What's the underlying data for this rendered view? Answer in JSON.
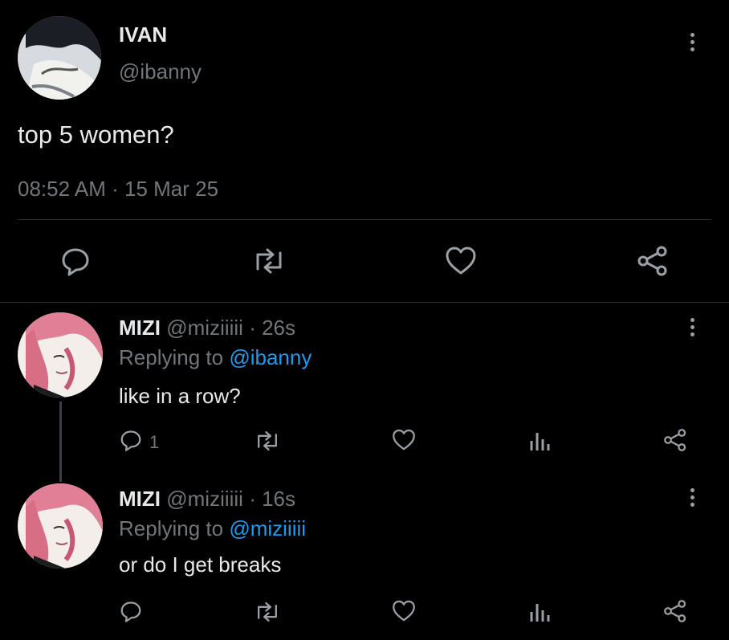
{
  "main_tweet": {
    "display_name": "IVAN",
    "handle": "@ibanny",
    "text": "top 5 women?",
    "timestamp": "08:52 AM",
    "separator": "·",
    "date": "15 Mar 25",
    "actions": [
      "comment-icon",
      "retweet-icon",
      "heart-icon",
      "share-icon"
    ]
  },
  "replies": [
    {
      "display_name": "MIZI",
      "handle": "@miziiiii",
      "dot": "·",
      "time": "26s",
      "replying_prefix": "Replying to",
      "replying_to": "@ibanny",
      "text": "like in a row?",
      "reply_count": "1"
    },
    {
      "display_name": "MIZI",
      "handle": "@miziiiii",
      "dot": "·",
      "time": "16s",
      "replying_prefix": "Replying to",
      "replying_to": "@miziiiii",
      "text": "or do I get breaks",
      "reply_count": ""
    }
  ],
  "colors": {
    "background": "#000000",
    "text": "#e7e9ea",
    "muted": "#71767b",
    "link": "#1d9bf0",
    "divider": "#2f3336"
  }
}
